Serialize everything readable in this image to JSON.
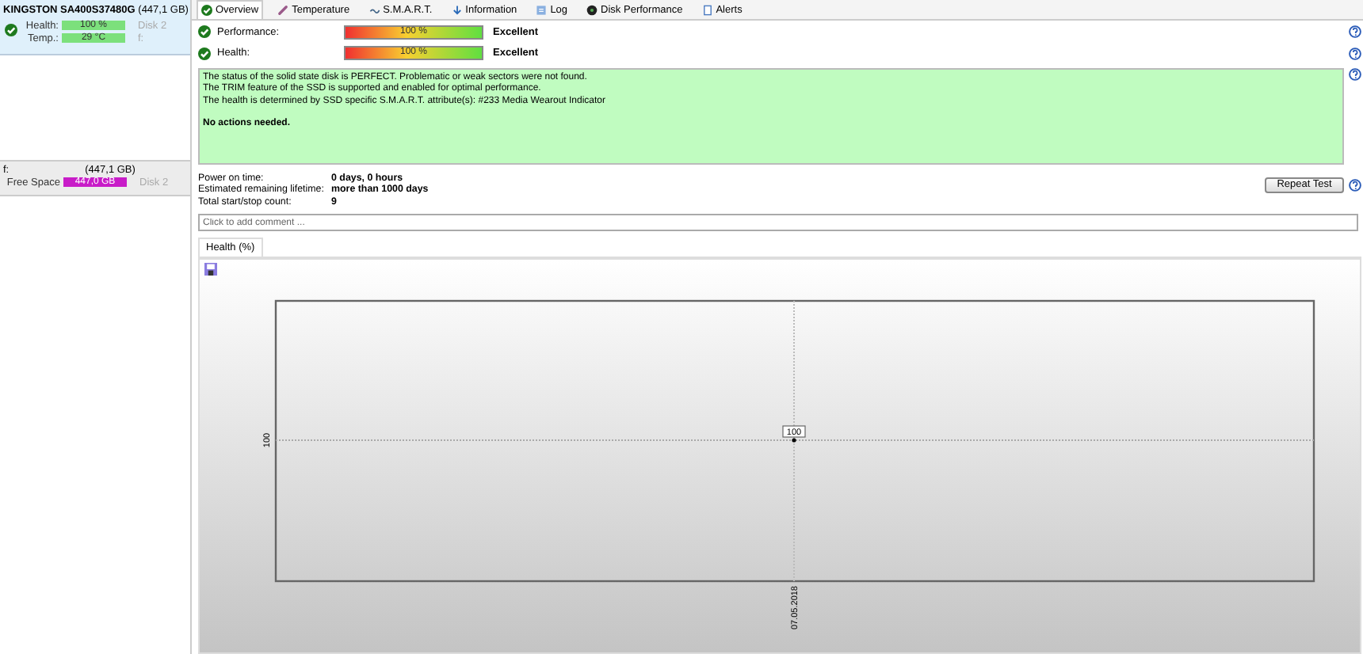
{
  "sidebar": {
    "disk": {
      "title": "**KINGSTON SA400S37480G** (447,1 GB)",
      "meters": [
        {
          "label": "Health:",
          "value": "100 %",
          "level": 1,
          "color": "#7ce07c",
          "note": "Disk 2"
        },
        {
          "label": "Temp.:",
          "value": "29 °C",
          "level": 1,
          "color": "#7ce07c",
          "note": "f:"
        }
      ]
    },
    "partition": {
      "name": "f:",
      "size": "(447,1 GB)",
      "meter": {
        "label": "Free Space",
        "value": "447,0 GB",
        "level": 1,
        "color": "#c81cc8",
        "note": "Disk 2"
      }
    }
  },
  "tabs": [
    {
      "label": "Overview",
      "selected": true
    },
    {
      "label": "Temperature",
      "selected": false
    },
    {
      "label": "S.M.A.R.T.",
      "selected": false
    },
    {
      "label": "Information",
      "selected": false
    },
    {
      "label": "Log",
      "selected": false
    },
    {
      "label": "Disk Performance",
      "selected": false
    },
    {
      "label": "Alerts",
      "selected": false
    }
  ],
  "ratings": [
    {
      "label": "Performance:",
      "value": "100 %",
      "level": 1,
      "verdict": "Excellent"
    },
    {
      "label": "Health:",
      "value": "100 %",
      "level": 1,
      "verdict": "Excellent"
    }
  ],
  "status_box": {
    "lines": [
      "The status of the solid state disk is PERFECT. Problematic or weak sectors were not found.",
      "The TRIM feature of the SSD is supported and enabled for optimal performance.",
      "The health is determined by SSD specific S.M.A.R.T. attribute(s):  #233 Media Wearout Indicator"
    ],
    "action": "No actions needed."
  },
  "stats": [
    {
      "label": "Power on time:",
      "value": "0 days, 0 hours"
    },
    {
      "label": "Estimated remaining lifetime:",
      "value": "more than 1000 days"
    },
    {
      "label": "Total start/stop count:",
      "value": "9"
    }
  ],
  "repeat_button": "Repeat Test",
  "comment": {
    "placeholder": "Click to add comment ..."
  },
  "chart_tabs": [
    {
      "label": "Health (%)",
      "selected": true
    }
  ],
  "chart": {
    "y_axis_text": "100",
    "x_axis_text": "07.05.2018",
    "point_label": "100"
  }
}
